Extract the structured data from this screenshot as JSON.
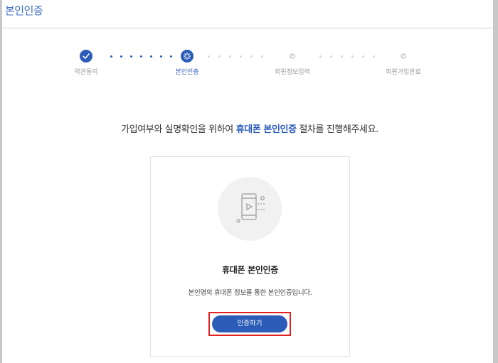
{
  "header": {
    "title": "본인인증"
  },
  "steps": [
    {
      "label": "약관동의",
      "state": "done"
    },
    {
      "label": "본인인증",
      "state": "active"
    },
    {
      "label": "회원정보입력",
      "state": "pending"
    },
    {
      "label": "회원가입완료",
      "state": "pending"
    }
  ],
  "intro": {
    "before": "가입여부와 실명확인을 위하여 ",
    "highlight": "휴대폰 본인인증",
    "after": " 절차를 진행해주세요."
  },
  "card": {
    "icon": "phone-play-icon",
    "title": "휴대폰 본인인증",
    "description": "본인명의 휴대폰 정보를 통한 본인인증입니다.",
    "button_label": "인증하기"
  },
  "colors": {
    "accent": "#2b5cb8",
    "highlight_box": "#e02020",
    "title": "#3d6ec2"
  }
}
